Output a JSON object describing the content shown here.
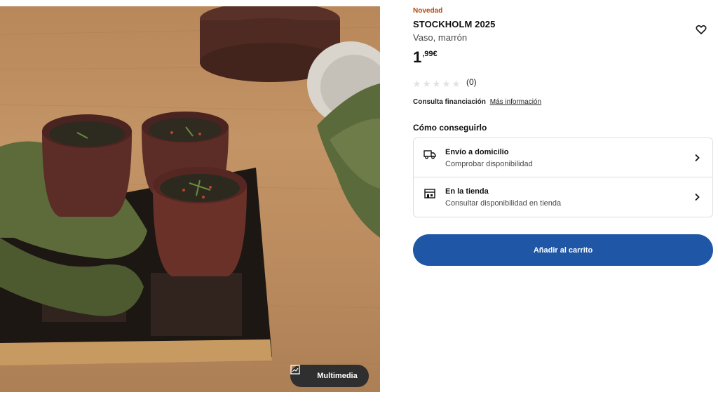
{
  "product": {
    "badge": "Novedad",
    "name": "STOCKHOLM 2025",
    "description": "Vaso, marrón",
    "price_integer": "1",
    "price_decimal": ",99€",
    "rating_count": "(0)",
    "rating_value": 0,
    "rating_max": 5
  },
  "financing": {
    "label": "Consulta financiación",
    "link": "Más información"
  },
  "delivery": {
    "heading": "Cómo conseguirlo",
    "options": [
      {
        "icon": "truck-icon",
        "title": "Envío a domicilio",
        "subtitle": "Comprobar disponibilidad"
      },
      {
        "icon": "store-icon",
        "title": "En la tienda",
        "subtitle": "Consultar disponibilidad en tienda"
      }
    ]
  },
  "actions": {
    "add_to_cart": "Añadir al carrito",
    "multimedia": "Multimedia",
    "favorite_icon": "heart-icon"
  },
  "colors": {
    "badge": "#b34a12",
    "primary_button": "#1f56a5",
    "multimedia_button": "#2f2f2f"
  }
}
